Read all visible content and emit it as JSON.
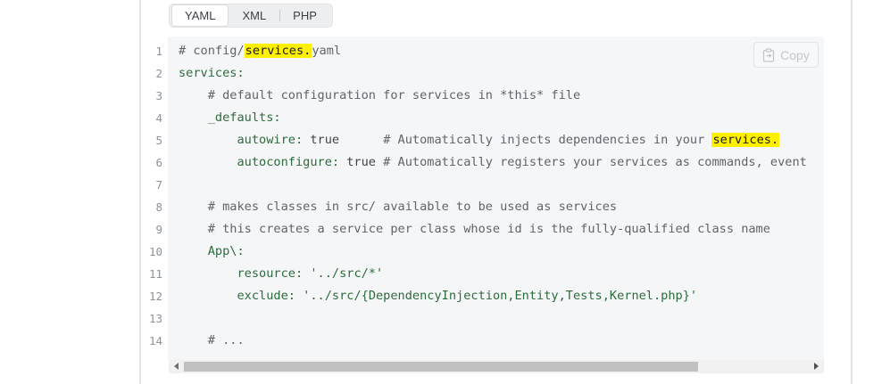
{
  "tabs": [
    {
      "label": "YAML",
      "active": true
    },
    {
      "label": "XML",
      "active": false
    },
    {
      "label": "PHP",
      "active": false
    }
  ],
  "copy_label": "Copy",
  "highlight_color": "#fff000",
  "lines": [
    {
      "n": "1",
      "parts": [
        [
          "comment",
          "# config/"
        ],
        [
          "mark",
          "services."
        ],
        [
          "comment",
          "yaml"
        ]
      ]
    },
    {
      "n": "2",
      "parts": [
        [
          "key",
          "services:"
        ]
      ]
    },
    {
      "n": "3",
      "parts": [
        [
          "plain",
          "    "
        ],
        [
          "comment",
          "# default configuration for services in *this* file"
        ]
      ]
    },
    {
      "n": "4",
      "parts": [
        [
          "plain",
          "    "
        ],
        [
          "key",
          "_defaults:"
        ]
      ]
    },
    {
      "n": "5",
      "parts": [
        [
          "plain",
          "        "
        ],
        [
          "key",
          "autowire:"
        ],
        [
          "plain",
          " true      "
        ],
        [
          "comment",
          "# Automatically injects dependencies in your "
        ],
        [
          "mark",
          "services."
        ]
      ]
    },
    {
      "n": "6",
      "parts": [
        [
          "plain",
          "        "
        ],
        [
          "key",
          "autoconfigure:"
        ],
        [
          "plain",
          " true "
        ],
        [
          "comment",
          "# Automatically registers your services as commands, event"
        ]
      ]
    },
    {
      "n": "7",
      "parts": []
    },
    {
      "n": "8",
      "parts": [
        [
          "plain",
          "    "
        ],
        [
          "comment",
          "# makes classes in src/ available to be used as services"
        ]
      ]
    },
    {
      "n": "9",
      "parts": [
        [
          "plain",
          "    "
        ],
        [
          "comment",
          "# this creates a service per class whose id is the fully-qualified class name"
        ]
      ]
    },
    {
      "n": "10",
      "parts": [
        [
          "plain",
          "    "
        ],
        [
          "key",
          "App\\:"
        ]
      ]
    },
    {
      "n": "11",
      "parts": [
        [
          "plain",
          "        "
        ],
        [
          "key",
          "resource:"
        ],
        [
          "plain",
          " "
        ],
        [
          "str",
          "'../src/*'"
        ]
      ]
    },
    {
      "n": "12",
      "parts": [
        [
          "plain",
          "        "
        ],
        [
          "key",
          "exclude:"
        ],
        [
          "plain",
          " "
        ],
        [
          "str",
          "'../src/{DependencyInjection,Entity,Tests,Kernel.php}'"
        ]
      ]
    },
    {
      "n": "13",
      "parts": []
    },
    {
      "n": "14",
      "parts": [
        [
          "plain",
          "    "
        ],
        [
          "comment",
          "# ..."
        ]
      ]
    }
  ]
}
